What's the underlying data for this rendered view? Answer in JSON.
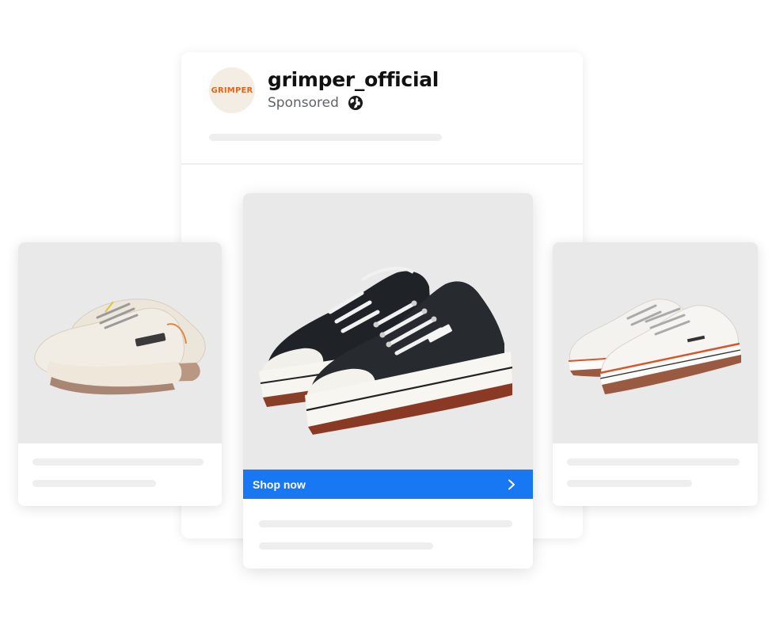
{
  "post": {
    "avatar_text": "GRIMPER",
    "username": "grimper_official",
    "sponsored": "Sponsored",
    "globe_icon": "globe-icon"
  },
  "carousel": {
    "cta_label": "Shop now",
    "cta_icon": "chevron-right-icon",
    "cards": [
      {
        "product": "chunky-sneaker",
        "position": "left"
      },
      {
        "product": "black-platform-sneaker",
        "position": "center"
      },
      {
        "product": "white-platform-sneaker",
        "position": "right"
      }
    ]
  },
  "colors": {
    "cta_blue": "#1877f2",
    "brand_orange": "#e0661e",
    "placeholder_gray": "#eeeeee",
    "image_bg": "#e9e9e9"
  }
}
